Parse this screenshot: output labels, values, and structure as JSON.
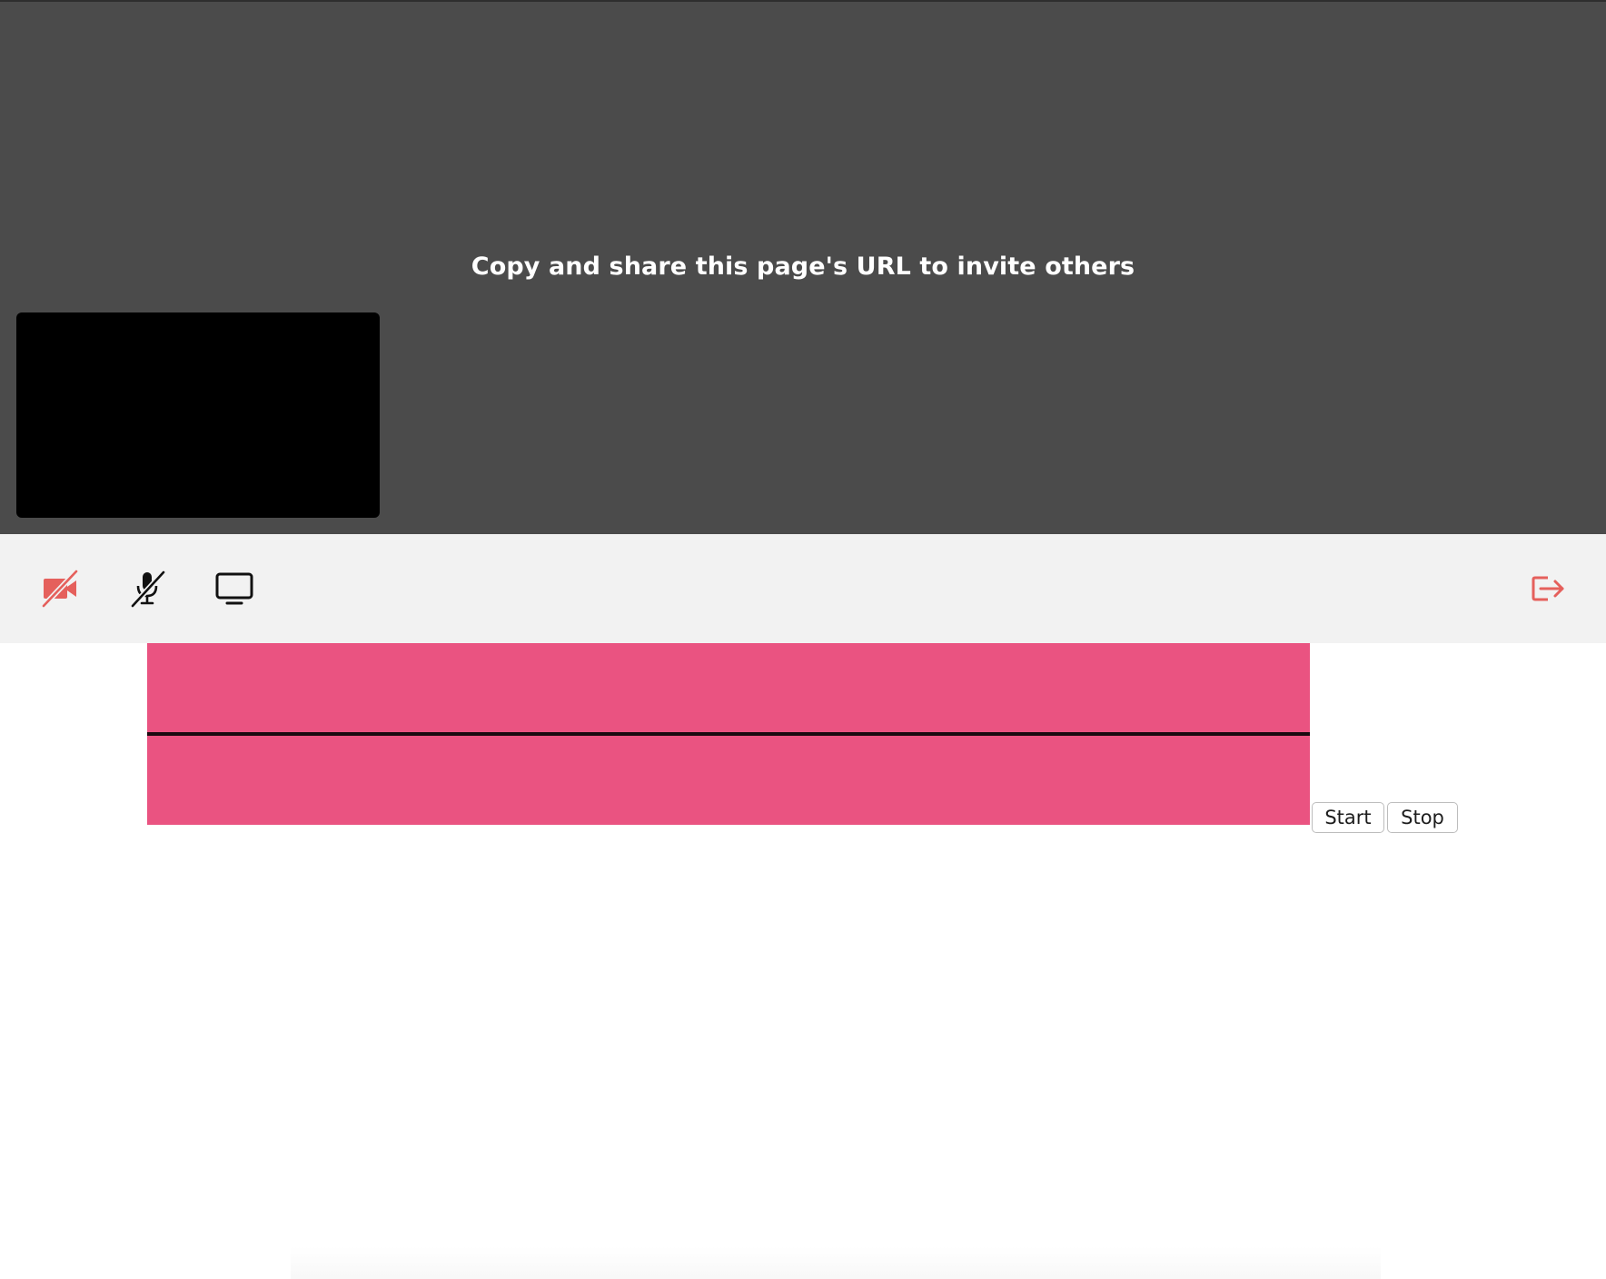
{
  "stage": {
    "invite_message": "Copy and share this page's URL to invite others"
  },
  "toolbar": {
    "camera_icon": "video-off-icon",
    "mic_icon": "microphone-off-icon",
    "screen_icon": "monitor-icon",
    "leave_icon": "sign-out-icon",
    "accent_color": "#e5605c"
  },
  "recorder": {
    "waveform_color": "#ea5381",
    "start_label": "Start",
    "stop_label": "Stop"
  }
}
